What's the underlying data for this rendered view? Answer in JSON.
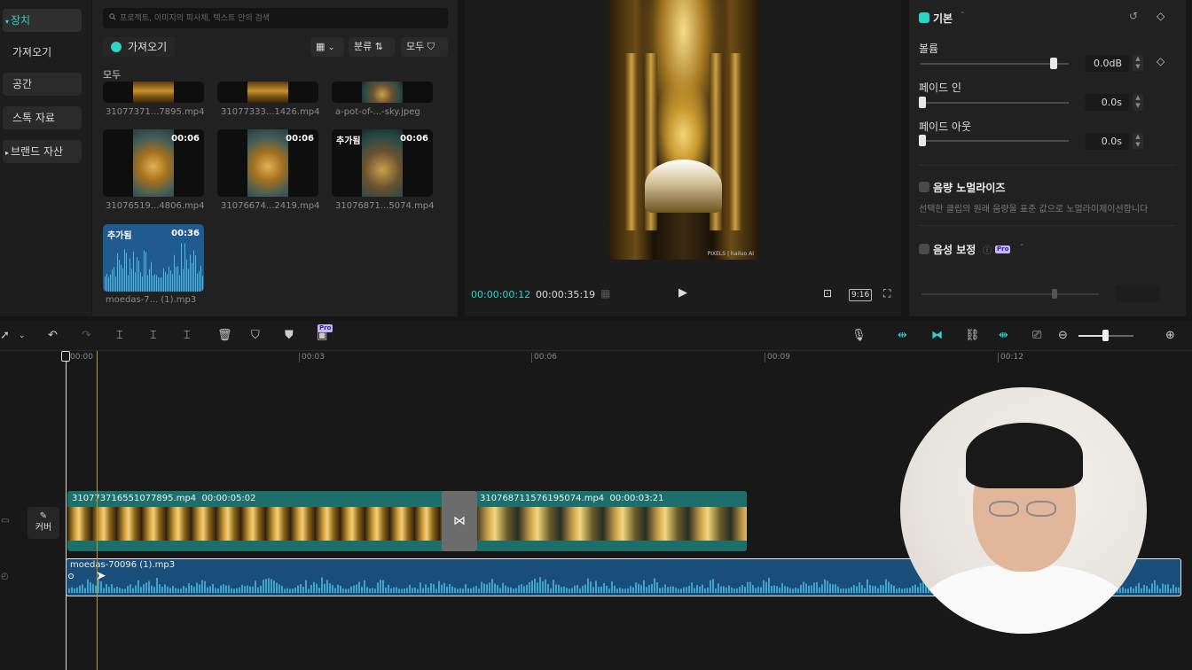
{
  "sidebar": {
    "items": [
      {
        "label": "장치",
        "expander": "▾"
      },
      {
        "label": "가져오기"
      },
      {
        "label": "공간"
      },
      {
        "label": "스톡 자료"
      },
      {
        "label": "브랜드 자산",
        "expander": "▸"
      }
    ]
  },
  "media": {
    "search_placeholder": "프로젝트, 이미지의 피사체, 텍스트 안의 검색",
    "import_label": "가져오기",
    "sort_label": "분류",
    "filter_label": "모두",
    "section_label": "모두",
    "items": [
      {
        "name": "31077371...7895.mp4"
      },
      {
        "name": "31077333...1426.mp4"
      },
      {
        "name": "a-pot-of-...-sky.jpeg"
      },
      {
        "name": "31076519...4806.mp4",
        "duration": "00:06"
      },
      {
        "name": "31076674...2419.mp4",
        "duration": "00:06"
      },
      {
        "name": "31076871...5074.mp4",
        "duration": "00:06",
        "badge": "추가됨"
      },
      {
        "name": "moedas-7... (1).mp3",
        "duration": "00:36",
        "badge": "추가됨"
      }
    ]
  },
  "player": {
    "current_time": "00:00:00:12",
    "total_time": "00:00:35:19",
    "aspect_ratio": "9:16",
    "watermark": "PIXELS | hailuo AI"
  },
  "inspector": {
    "section_title": "기본",
    "volume_label": "볼륨",
    "volume_value": "0.0dB",
    "volume_level": 0.9,
    "fade_in_label": "페이드 인",
    "fade_in_value": "0.0s",
    "fade_out_label": "페이드 아웃",
    "fade_out_value": "0.0s",
    "normalize_label": "음량 노멀라이즈",
    "normalize_desc": "선택한 클립의 원래 음량을 표준 값으로 노멀라이제이션합니다",
    "voice_enhance_label": "음성 보정",
    "pro_badge": "Pro"
  },
  "timeline": {
    "ticks": [
      "00:00",
      "00:03",
      "00:06",
      "00:09",
      "00:12"
    ],
    "cover_label": "커버",
    "clip1": {
      "name": "310773716551077895.mp4",
      "duration": "00:00:05:02"
    },
    "clip2": {
      "name": "310768711576195074.mp4",
      "duration": "00:00:03:21"
    },
    "audio_clip": {
      "name": "moedas-70096 (1).mp3"
    }
  },
  "colors": {
    "accent": "#2ad4c6",
    "video_track": "#1c6f6a",
    "audio_track": "#1a4e7a"
  }
}
